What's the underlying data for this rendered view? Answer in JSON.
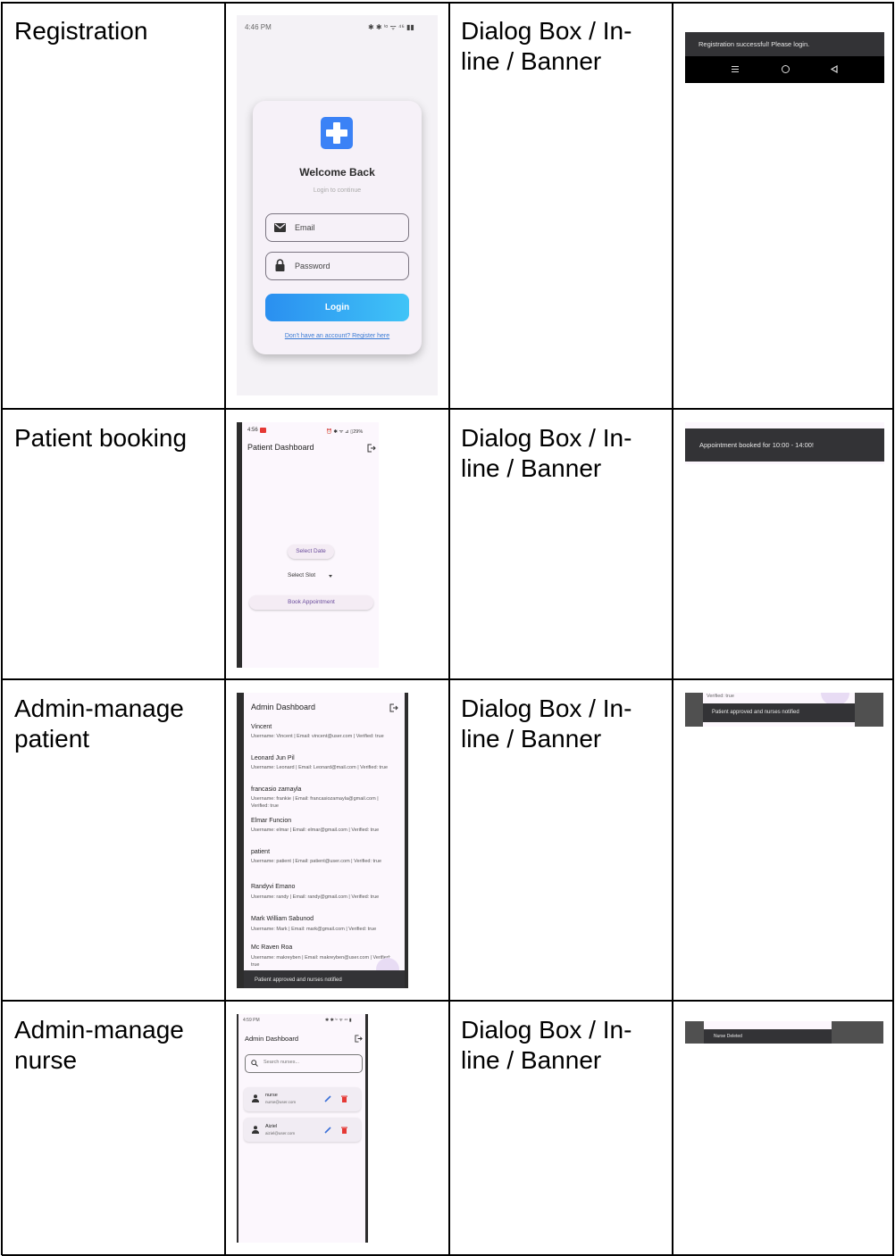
{
  "rows": [
    {
      "feature": "Registration",
      "type": [
        "Dialog Box / In-",
        "line / Banner"
      ],
      "screenshot": {
        "status_time": "4:46 PM",
        "status_icons": "✱ ✱ ⁱᵒ ᯤ ⁴⁶ ▮▮",
        "title": "Welcome Back",
        "subtitle": "Login to continue",
        "email_label": "Email",
        "password_label": "Password",
        "login_button": "Login",
        "register_link": "Don't have an account? Register here"
      },
      "feedback": {
        "message": "Registration successful! Please login.",
        "nav_menu_icon": "menu-icon",
        "nav_home_icon": "home-icon",
        "nav_back_icon": "back-icon"
      }
    },
    {
      "feature": "Patient booking",
      "type": [
        "Dialog Box / In-",
        "line / Banner"
      ],
      "screenshot": {
        "status_time": "4:56",
        "status_icons": "⏰ ✱ ᯤ ⊿ ▯29%",
        "title": "Patient Dashboard",
        "select_date": "Select Date",
        "select_slot": "Select Slot",
        "book_button": "Book Appointment"
      },
      "feedback": {
        "message": "Appointment booked for 10:00 - 14:00!"
      }
    },
    {
      "feature": [
        "Admin-manage",
        "patient"
      ],
      "type": [
        "Dialog Box / In-",
        "line / Banner"
      ],
      "screenshot": {
        "title": "Admin Dashboard",
        "patients": [
          {
            "name": "Vincent",
            "info": "Username: Vincent | Email: vincent@user.com | Verified: true"
          },
          {
            "name": "Leonard Jun Pil",
            "info": "Username: Leonard | Email: Leonard@mail.com | Verified: true"
          },
          {
            "name": "francasio zamayla",
            "info": "Username: frankie | Email: francasiozamayla@gmail.com | Verified: true"
          },
          {
            "name": "Elmar Funcion",
            "info": "Username: elmar | Email: elmar@gmail.com | Verified: true"
          },
          {
            "name": "patient",
            "info": "Username: patient | Email: patient@user.com | Verified: true"
          },
          {
            "name": "Randyvi Emano",
            "info": "Username: randy | Email: randy@gmail.com | Verified: true"
          },
          {
            "name": "Mark William Sabunod",
            "info": "Username: Mark | Email: mark@gmail.com | Verified: true"
          },
          {
            "name": "Mc Raven Roa",
            "info": "Username: makreyben | Email: makreyben@user.com | Verified: true"
          }
        ],
        "snackbar": "Patient approved and nurses notified"
      },
      "feedback": {
        "top_text": "Verified: true",
        "message": "Patient approved and nurses notified"
      }
    },
    {
      "feature": [
        "Admin-manage",
        "nurse"
      ],
      "type": [
        "Dialog Box / In-",
        "line / Banner"
      ],
      "screenshot": {
        "status_time": "4:59 PM",
        "status_icons": "✱ ✱ ⁱᵒ ᯤ ⁴⁶ ▮",
        "title": "Admin Dashboard",
        "search_placeholder": "Search nurses...",
        "nurses": [
          {
            "name": "nurse",
            "email": "nurse@user.com"
          },
          {
            "name": "Aiziel",
            "email": "aiziel@user.com"
          }
        ]
      },
      "feedback": {
        "message": "Nurse Deleted"
      }
    }
  ],
  "colors": {
    "login_gradient_start": "#2a8ff0",
    "login_gradient_end": "#40c4f7",
    "logo_blue": "#3b82f6",
    "snackbar_dark": "#333336",
    "edit_icon": "#3a6fd8",
    "delete_icon": "#e53935"
  }
}
